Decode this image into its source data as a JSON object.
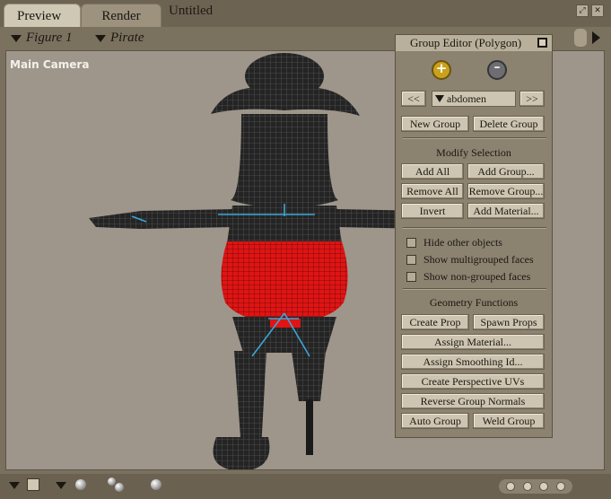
{
  "tabs": [
    {
      "label": "Preview",
      "active": true
    },
    {
      "label": "Render",
      "active": false
    }
  ],
  "document_title": "Untitled",
  "figure_selector": {
    "figure": "Figure 1",
    "actor": "Pirate"
  },
  "viewport": {
    "camera_label": "Main Camera"
  },
  "group_editor": {
    "title": "Group Editor  (Polygon)",
    "prev_label": "<<",
    "next_label": ">>",
    "current_group": "abdomen",
    "new_group": "New Group",
    "delete_group": "Delete Group",
    "modify_selection_label": "Modify Selection",
    "add_all": "Add All",
    "add_group": "Add Group...",
    "remove_all": "Remove All",
    "remove_group": "Remove Group...",
    "invert": "Invert",
    "add_material": "Add Material...",
    "options": [
      {
        "label": "Hide other objects",
        "checked": false
      },
      {
        "label": "Show multigrouped faces",
        "checked": false
      },
      {
        "label": "Show non-grouped faces",
        "checked": false
      }
    ],
    "geometry_functions_label": "Geometry Functions",
    "create_prop": "Create Prop",
    "spawn_props": "Spawn Props",
    "assign_material": "Assign Material...",
    "assign_smoothing_id": "Assign Smoothing Id...",
    "create_perspective_uvs": "Create Perspective UVs",
    "reverse_group_normals": "Reverse Group Normals",
    "auto_group": "Auto Group",
    "weld_group": "Weld Group"
  },
  "colors": {
    "selected_faces": "#e01010",
    "mesh": "#1c1c1c",
    "bones": "#3aa6d8",
    "viewport_bg": "#9e968b"
  }
}
